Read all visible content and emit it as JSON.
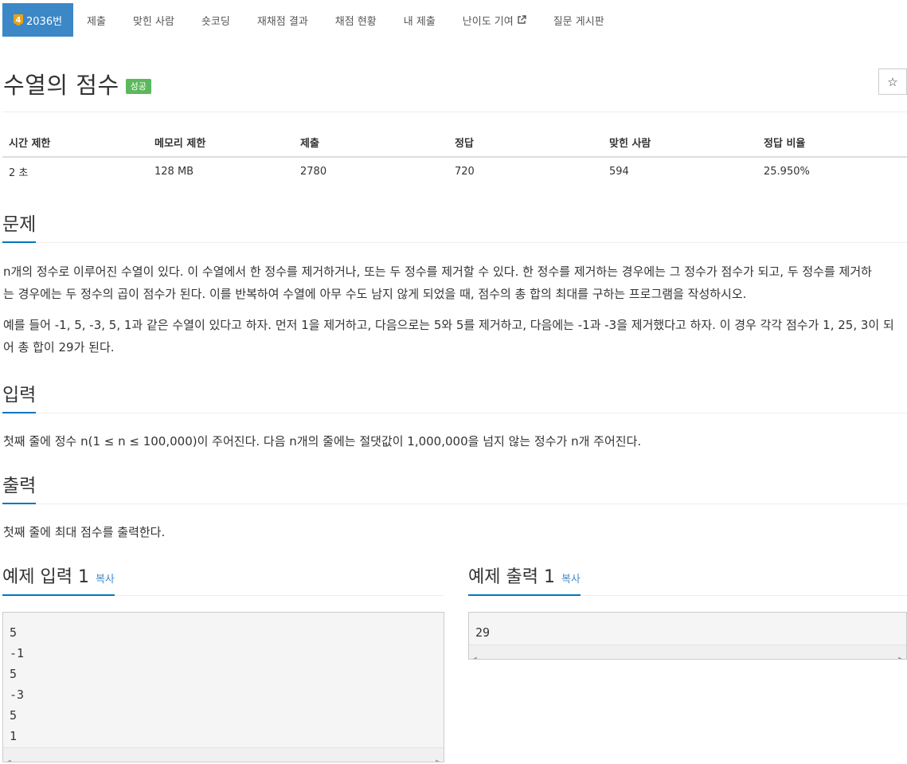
{
  "nav": {
    "problem_tier": "4",
    "problem_number": "2036번",
    "items": [
      "제출",
      "맞힌 사람",
      "숏코딩",
      "재채점 결과",
      "채점 현황",
      "내 제출",
      "난이도 기여",
      "질문 게시판"
    ]
  },
  "header": {
    "title": "수열의 점수",
    "status": "성공",
    "star_glyph": "☆"
  },
  "info": {
    "headers": [
      "시간 제한",
      "메모리 제한",
      "제출",
      "정답",
      "맞힌 사람",
      "정답 비율"
    ],
    "values": [
      "2 초",
      "128 MB",
      "2780",
      "720",
      "594",
      "25.950%"
    ]
  },
  "problem": {
    "heading": "문제",
    "para1_line1": "n개의 정수로 이루어진 수열이 있다. 이 수열에서 한 정수를 제거하거나, 또는 두 정수를 제거할 수 있다. 한 정수를 제거하는 경우에는 그 정수가 점수가 되고, 두 정수를 제거하",
    "para1_line2": "는 경우에는 두 정수의 곱이 점수가 된다. 이를 반복하여 수열에 아무 수도 남지 않게 되었을 때, 점수의 총 합의 최대를 구하는 프로그램을 작성하시오.",
    "para2_line1": "예를 들어 -1, 5, -3, 5, 1과 같은 수열이 있다고 하자. 먼저 1을 제거하고, 다음으로는 5와 5를 제거하고, 다음에는 -1과 -3을 제거했다고 하자. 이 경우 각각 점수가 1, 25, 3이 되",
    "para2_line2": "어 총 합이 29가 된다."
  },
  "input": {
    "heading": "입력",
    "text": "첫째 줄에 정수 n(1 ≤ n ≤ 100,000)이 주어진다. 다음 n개의 줄에는 절댓값이 1,000,000을 넘지 않는 정수가 n개 주어진다."
  },
  "output": {
    "heading": "출력",
    "text": "첫째 줄에 최대 점수를 출력한다."
  },
  "samples": {
    "input_title": "예제 입력 1",
    "output_title": "예제 출력 1",
    "copy_label": "복사",
    "input_lines": [
      "5",
      "-1",
      "5",
      "-3",
      "5",
      "1"
    ],
    "output_lines": [
      "29"
    ]
  },
  "colors": {
    "nav_active": "#3c87c6",
    "tier_gold": "#e6a21e",
    "success_badge": "#5cb85c",
    "section_underline": "#0076c0",
    "link": "#428bca"
  }
}
